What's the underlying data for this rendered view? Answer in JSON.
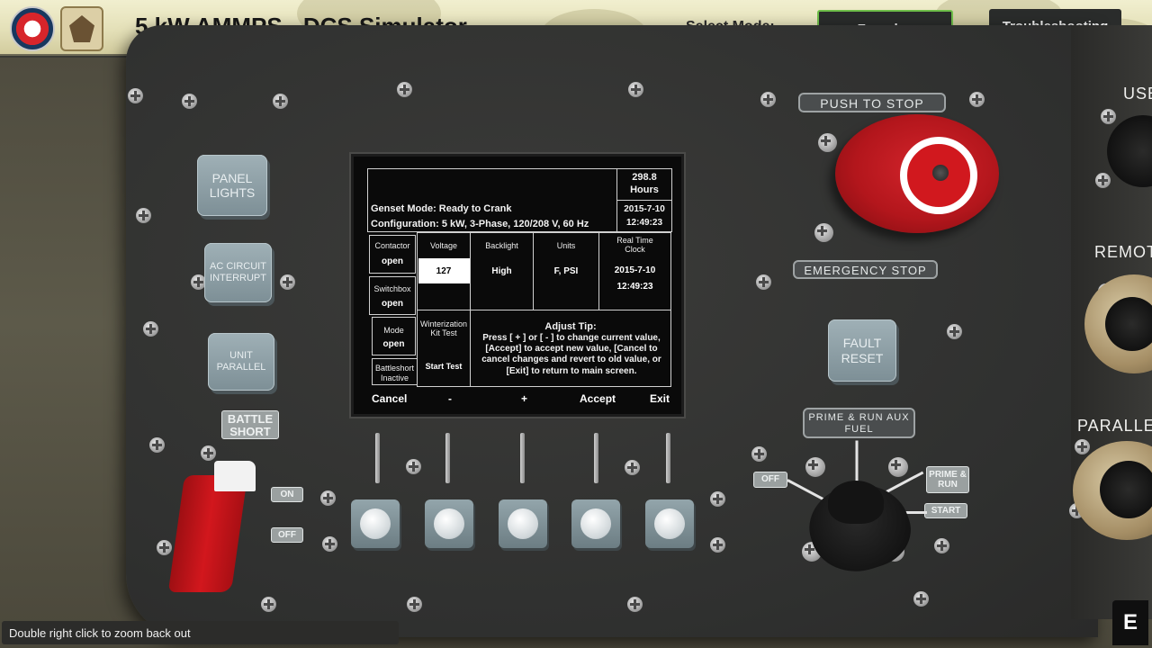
{
  "header": {
    "title": "5 kW AMMPS - DCS Simulator",
    "select_mode_label": "Select Mode:",
    "modes": [
      {
        "label": "Freeplay",
        "active": true
      },
      {
        "label": "Troubleshooting",
        "active": false
      }
    ],
    "accent_active": "#6fbf4a"
  },
  "panel": {
    "panel_lights": "PANEL LIGHTS",
    "ac_circuit_interrupt": "AC CIRCUIT INTERRUPT",
    "unit_parallel": "UNIT PARALLEL",
    "battle_short": "BATTLE SHORT",
    "switch_on": "ON",
    "switch_off": "OFF",
    "push_to_stop": "PUSH TO STOP",
    "emergency_stop": "EMERGENCY STOP",
    "fault_reset": "FAULT RESET",
    "prime_run_aux": "PRIME & RUN AUX FUEL",
    "rotary_off": "OFF",
    "rotary_prime_run": "PRIME & RUN",
    "rotary_start": "START",
    "side_use": "USE",
    "side_remote": "REMOTE",
    "side_parallel": "PARALLEL"
  },
  "display": {
    "hours_value": "298.8",
    "hours_label": "Hours",
    "date_top": "2015-7-10",
    "time_top": "12:49:23",
    "genset_mode": "Genset Mode: Ready to Crank",
    "configuration": "Configuration:  5 kW, 3-Phase, 120/208 V, 60 Hz",
    "status": [
      {
        "label": "Contactor",
        "value": "open"
      },
      {
        "label": "Switchbox",
        "value": "open"
      },
      {
        "label": "Mode",
        "value": "open"
      },
      {
        "label": "Battleshort",
        "value": "Inactive"
      }
    ],
    "settings": [
      {
        "label": "Voltage",
        "value": "127"
      },
      {
        "label": "Backlight",
        "value": "High"
      },
      {
        "label": "Units",
        "value": "F, PSI"
      }
    ],
    "clock_label": "Real Time Clock",
    "clock_date": "2015-7-10",
    "clock_time": "12:49:23",
    "winterization_label": "Winterization Kit Test",
    "winterization_value": "Start Test",
    "tip_title": "Adjust Tip:",
    "tip_body": "Press [ + ] or [ - ] to change current value, [Accept] to accept new value, [Cancel to cancel changes and revert to old value, or [Exit] to return to main screen.",
    "softkeys": [
      "Cancel",
      "-",
      "+",
      "Accept",
      "Exit"
    ]
  },
  "footer": {
    "status_text": "Double right click to zoom back out",
    "e_button": "E"
  }
}
